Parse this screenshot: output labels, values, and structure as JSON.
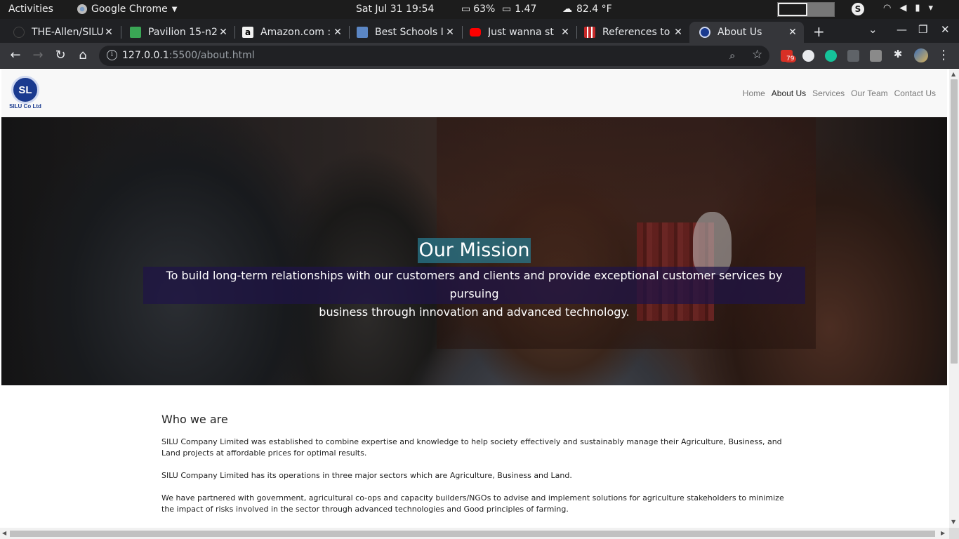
{
  "topbar": {
    "activities": "Activities",
    "app_name": "Google Chrome",
    "clock": "Sat Jul 31  19:54",
    "cpu": "63%",
    "load": "1.47",
    "weather": "82.4 °F",
    "skype_letter": "S"
  },
  "tabs": [
    {
      "title": "THE-Allen/SILU",
      "favicon_color": "#202124",
      "icon": "github-icon"
    },
    {
      "title": "Pavilion 15-n2",
      "favicon_color": "#3aa655",
      "icon": "document-icon"
    },
    {
      "title": "Amazon.com :",
      "favicon_color": "#f2f2f2",
      "icon": "amazon-icon"
    },
    {
      "title": "Best Schools I",
      "favicon_color": "#5b86c4",
      "icon": "school-icon"
    },
    {
      "title": "Just wanna st",
      "favicon_color": "#ff0000",
      "icon": "youtube-icon"
    },
    {
      "title": "References to",
      "favicon_color": "#c62828",
      "icon": "document-icon"
    },
    {
      "title": "About Us",
      "favicon_color": "#1a3a8f",
      "icon": "site-logo-icon",
      "active": true
    }
  ],
  "toolbar": {
    "url_host": "127.0.0.1",
    "url_path": ":5500/about.html",
    "ext_badge": "79"
  },
  "site": {
    "logo_initials": "SL",
    "logo_caption": "SILU Co Ltd",
    "nav": [
      "Home",
      "About Us",
      "Services",
      "Our Team",
      "Contact Us"
    ],
    "active_nav": "About Us",
    "hero_title": "Our Mission",
    "hero_text_line1": "To build long-term relationships with our customers and clients and provide exceptional customer services by pursuing",
    "hero_text_line2": "business through innovation and advanced technology.",
    "about_heading": "Who we are",
    "about_p1": "SILU Company Limited was established to combine expertise and knowledge to help society effectively and sustainably manage their Agriculture, Business, and Land projects at affordable prices for optimal results.",
    "about_p2": "SILU Company Limited has its operations in three major sectors which are Agriculture, Business and Land.",
    "about_p3": "We have partnered with government, agricultural co-ops and capacity builders/NGOs to advise and implement solutions for agriculture stakeholders to minimize the impact of risks involved in the sector through advanced technologies and Good principles of farming."
  },
  "colors": {
    "topbar_bg": "#1c1c1c",
    "tabstrip_bg": "#202124",
    "toolbar_bg": "#35363a",
    "hero_title_bg": "#28788c",
    "hero_text_bg": "#1e1446"
  }
}
